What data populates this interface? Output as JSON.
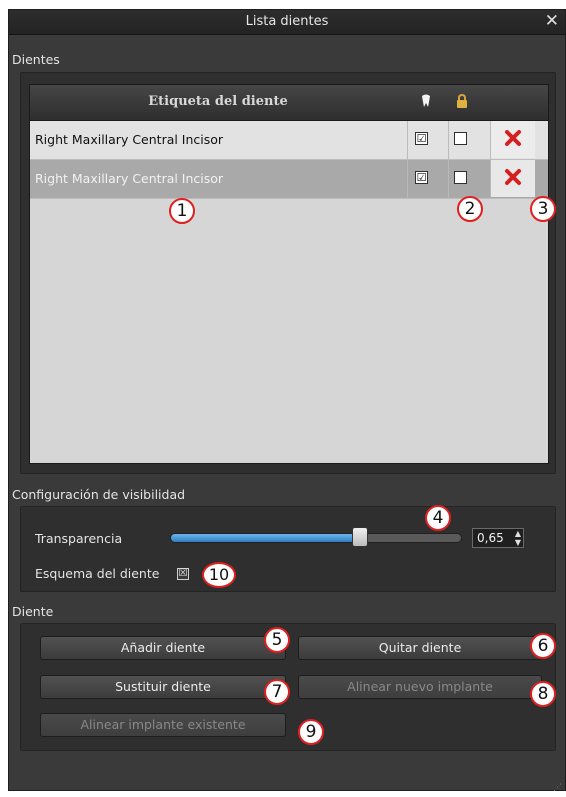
{
  "window": {
    "title": "Lista dientes",
    "close_glyph": "✕"
  },
  "teeth": {
    "section_label": "Dientes",
    "header": {
      "label": "Etiqueta del diente",
      "visible_icon": "tooth-icon",
      "lock_icon": "lock-icon"
    },
    "rows": [
      {
        "label": "Right Maxillary Central Incisor",
        "visible": "☑",
        "locked": "",
        "delete_icon": "delete-icon"
      },
      {
        "label": "Right Maxillary Central Incisor",
        "visible": "☑",
        "locked": "",
        "delete_icon": "delete-icon"
      }
    ]
  },
  "visibility": {
    "section_label": "Configuración de visibilidad",
    "transparency_label": "Transparencia",
    "transparency_value": "0,65",
    "transparency_fraction": 0.65,
    "outline_label": "Esquema del diente",
    "outline_checked": "☒"
  },
  "tooth": {
    "section_label": "Diente",
    "add_label": "Añadir diente",
    "remove_label": "Quitar diente",
    "replace_label": "Sustituir diente",
    "align_new_label": "Alinear nuevo implante",
    "align_existing_label": "Alinear implante existente"
  },
  "callouts": [
    "1",
    "2",
    "3",
    "4",
    "5",
    "6",
    "7",
    "8",
    "9",
    "10"
  ],
  "colors": {
    "accent_blue": "#2f7cc2",
    "callout_red": "#e02020",
    "delete_red": "#d42020"
  }
}
